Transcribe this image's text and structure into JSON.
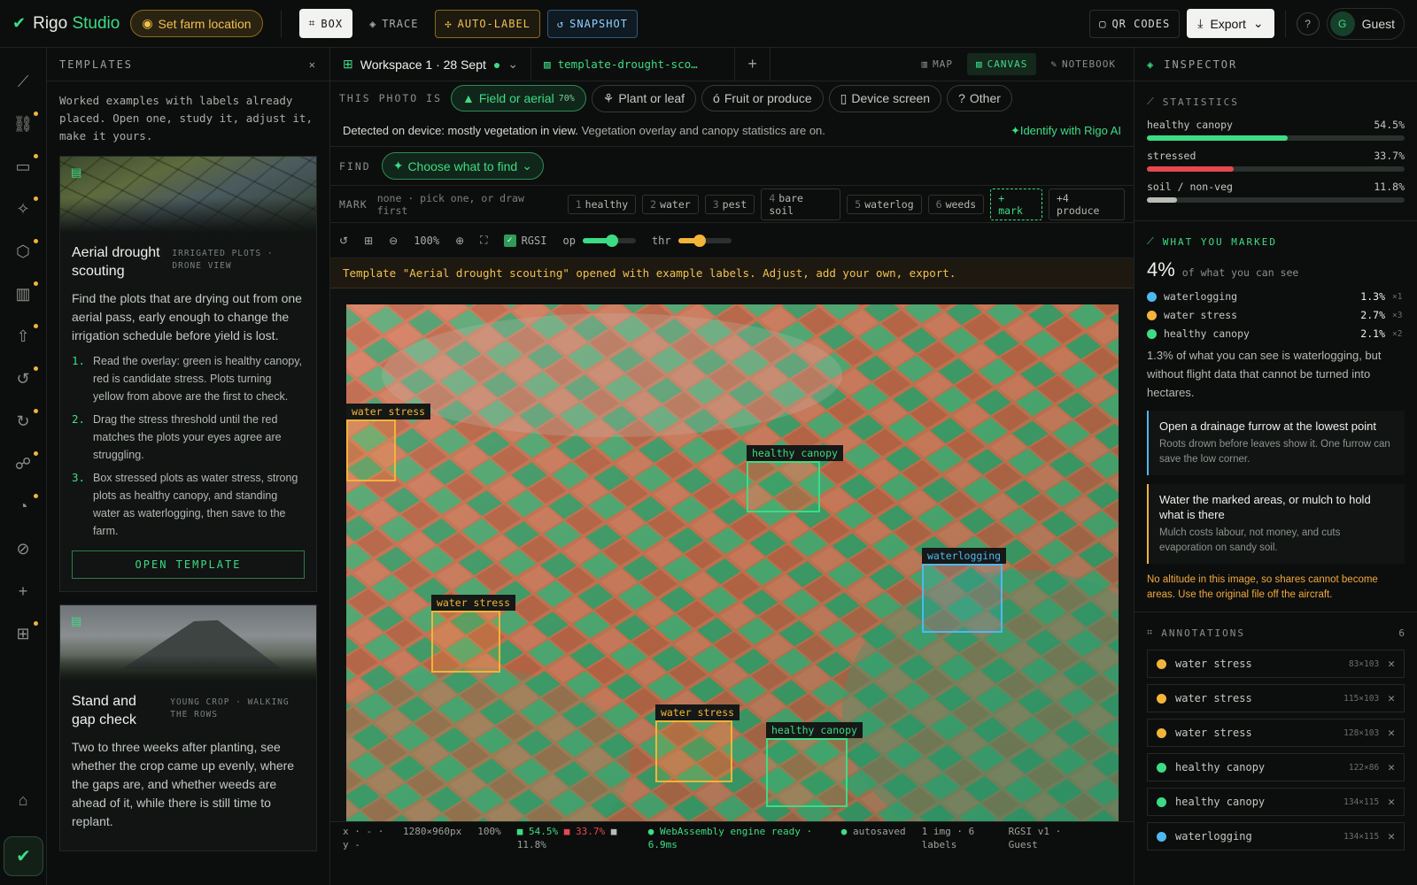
{
  "app": {
    "name_a": "Rigo",
    "name_b": "Studio",
    "location_btn": "Set farm location"
  },
  "toolbar": {
    "box": "BOX",
    "trace": "TRACE",
    "auto_label": "AUTO-LABEL",
    "snapshot": "SNAPSHOT",
    "qr": "QR CODES",
    "export": "Export",
    "user": "Guest",
    "avatar": "G"
  },
  "rail": {
    "items": [
      "chart-icon",
      "link-icon",
      "folder-icon",
      "sparkle-icon",
      "leaf-icon",
      "book-icon",
      "upload-icon",
      "history-icon",
      "history-alt-icon",
      "people-icon",
      "gauge-icon",
      "compass-icon",
      "plus-icon",
      "grid-icon",
      "home-icon"
    ]
  },
  "templates": {
    "title": "TEMPLATES",
    "intro": "Worked examples with labels already placed. Open one, study it, adjust it, make it yours.",
    "cards": [
      {
        "title": "Aerial drought scouting",
        "tag": "IRRIGATED PLOTS · DRONE VIEW",
        "desc": "Find the plots that are drying out from one aerial pass, early enough to change the irrigation schedule before yield is lost.",
        "steps": [
          "Read the overlay: green is healthy canopy, red is candidate stress. Plots turning yellow from above are the first to check.",
          "Drag the stress threshold until the red matches the plots your eyes agree are struggling.",
          "Box stressed plots as water stress, strong plots as healthy canopy, and standing water as waterlogging, then save to the farm."
        ],
        "button": "OPEN TEMPLATE"
      },
      {
        "title": "Stand and gap check",
        "tag": "YOUNG CROP · WALKING THE ROWS",
        "desc": "Two to three weeks after planting, see whether the crop came up evenly, where the gaps are, and whether weeds are ahead of it, while there is still time to replant."
      }
    ]
  },
  "tabs": {
    "workspace": "Workspace 1 · 28 Sept",
    "file": "template-drought-sco…",
    "views": [
      "MAP",
      "CANVAS",
      "NOTEBOOK"
    ]
  },
  "photo_is": {
    "label": "THIS PHOTO IS",
    "chips": [
      "Field or aerial",
      "Plant or leaf",
      "Fruit or produce",
      "Device screen",
      "Other"
    ],
    "confidence": "70%"
  },
  "detect": {
    "lead": "Detected on device: mostly vegetation in view.",
    "rest": "Vegetation overlay and canopy statistics are on.",
    "ai": "✦Identify with Rigo AI"
  },
  "find": {
    "label": "FIND",
    "button": "Choose what to find"
  },
  "mark": {
    "label": "MARK",
    "hint": "none · pick one, or draw first",
    "items": [
      {
        "k": "1",
        "t": "healthy"
      },
      {
        "k": "2",
        "t": "water"
      },
      {
        "k": "3",
        "t": "pest"
      },
      {
        "k": "4",
        "t": "bare soil"
      },
      {
        "k": "5",
        "t": "waterlog"
      },
      {
        "k": "6",
        "t": "weeds"
      }
    ],
    "add": "+ mark",
    "more": "+4 produce"
  },
  "tools": {
    "zoom": "100%",
    "rgsi": "RGSI",
    "op": "op",
    "thr": "thr",
    "op_level": 0.55,
    "thr_level": 0.4
  },
  "banner": "Template \"Aerial drought scouting\" opened with example labels. Adjust, add your own, export.",
  "boxes": [
    {
      "label": "water stress",
      "color": "#f2b43a"
    },
    {
      "label": "healthy canopy",
      "color": "#3ddc84"
    },
    {
      "label": "waterlogging",
      "color": "#4fb8f0"
    },
    {
      "label": "water stress",
      "color": "#f2b43a"
    },
    {
      "label": "water stress",
      "color": "#f2b43a"
    },
    {
      "label": "healthy canopy",
      "color": "#3ddc84"
    }
  ],
  "status": {
    "xy": "x · - · y -",
    "size": "1280×960px",
    "zoom": "100%",
    "green": "54.5%",
    "red": "33.7%",
    "grey": "11.8%",
    "engine": "WebAssembly engine ready · 6.9ms",
    "save": "autosaved",
    "count": "1 img · 6 labels",
    "ver": "RGSI v1 · Guest"
  },
  "inspector": {
    "title": "INSPECTOR",
    "stats_title": "STATISTICS",
    "stats": [
      {
        "name": "healthy canopy",
        "value": "54.5%",
        "frac": 0.545,
        "color": "#3ddc84"
      },
      {
        "name": "stressed",
        "value": "33.7%",
        "frac": 0.337,
        "color": "#e5484d"
      },
      {
        "name": "soil / non-veg",
        "value": "11.8%",
        "frac": 0.118,
        "color": "#b8bcb6"
      }
    ],
    "marked_title": "WHAT YOU MARKED",
    "marked_big": "4%",
    "marked_sub": "of what you can see",
    "marked": [
      {
        "name": "waterlogging",
        "value": "1.3%",
        "count": "×1",
        "color": "#4fb8f0"
      },
      {
        "name": "water stress",
        "value": "2.7%",
        "count": "×3",
        "color": "#f2b43a"
      },
      {
        "name": "healthy canopy",
        "value": "2.1%",
        "count": "×2",
        "color": "#3ddc84"
      }
    ],
    "summary": "1.3% of what you can see is waterlogging, but without flight data that cannot be turned into hectares.",
    "tips": [
      {
        "title": "Open a drainage furrow at the lowest point",
        "body": "Roots drown before leaves show it. One furrow can save the low corner.",
        "color": "#4fb8f0"
      },
      {
        "title": "Water the marked areas, or mulch to hold what is there",
        "body": "Mulch costs labour, not money, and cuts evaporation on sandy soil.",
        "color": "#f2b43a"
      }
    ],
    "warning": "No altitude in this image, so shares cannot become areas. Use the original file off the aircraft.",
    "ann_title": "ANNOTATIONS",
    "ann_count": "6",
    "annotations": [
      {
        "name": "water stress",
        "size": "83×103",
        "color": "#f2b43a"
      },
      {
        "name": "water stress",
        "size": "115×103",
        "color": "#f2b43a"
      },
      {
        "name": "water stress",
        "size": "128×103",
        "color": "#f2b43a"
      },
      {
        "name": "healthy canopy",
        "size": "122×86",
        "color": "#3ddc84"
      },
      {
        "name": "healthy canopy",
        "size": "134×115",
        "color": "#3ddc84"
      },
      {
        "name": "waterlogging",
        "size": "134×115",
        "color": "#4fb8f0"
      }
    ]
  }
}
